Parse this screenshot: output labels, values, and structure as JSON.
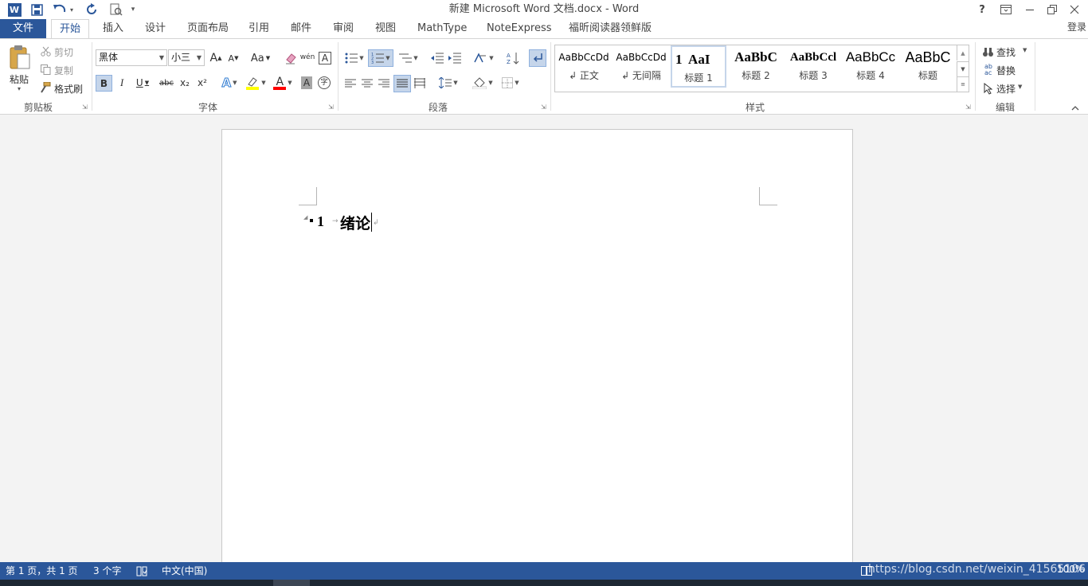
{
  "window": {
    "title": "新建 Microsoft Word 文档.docx - Word"
  },
  "titlebar": {
    "help": "?",
    "qat_more": "▾"
  },
  "tabs": {
    "file": "文件",
    "items": [
      "开始",
      "插入",
      "设计",
      "页面布局",
      "引用",
      "邮件",
      "审阅",
      "视图",
      "MathType",
      "NoteExpress",
      "福昕阅读器领鲜版"
    ],
    "login": "登录"
  },
  "clipboard": {
    "paste": "粘贴",
    "cut": "剪切",
    "copy": "复制",
    "format_painter": "格式刷",
    "label": "剪贴板"
  },
  "font": {
    "name": "黑体",
    "size": "小三",
    "grow": "A",
    "shrink": "A",
    "case": "Aa",
    "bold": "B",
    "italic": "I",
    "underline": "U",
    "strike": "abc",
    "sub": "x₂",
    "sup": "x²",
    "phonetic": "wén",
    "label": "字体"
  },
  "paragraph": {
    "label": "段落"
  },
  "styles": {
    "label": "样式",
    "items": [
      {
        "preview": "AaBbCcDd",
        "name": "↲ 正文"
      },
      {
        "preview": "AaBbCcDd",
        "name": "↲ 无间隔"
      },
      {
        "preview": "1  AaI",
        "name": "标题 1"
      },
      {
        "preview": "AaBbC",
        "name": "标题 2"
      },
      {
        "preview": "AaBbCcl",
        "name": "标题 3"
      },
      {
        "preview": "AaBbCc",
        "name": "标题 4"
      },
      {
        "preview": "AaBbC",
        "name": "标题"
      }
    ]
  },
  "editing": {
    "find": "查找",
    "replace": "替换",
    "select": "选择",
    "label": "编辑"
  },
  "document": {
    "heading_number": "1",
    "heading_text": "绪论"
  },
  "status": {
    "page": "第 1 页，共 1 页",
    "words": "3 个字",
    "language": "中文(中国)",
    "watermark": "https://blog.csdn.net/weixin_41565106",
    "zoom": "100%"
  },
  "colors": {
    "accent": "#2b579a",
    "highlight": "#ffff00",
    "font_color": "#ff0000"
  }
}
